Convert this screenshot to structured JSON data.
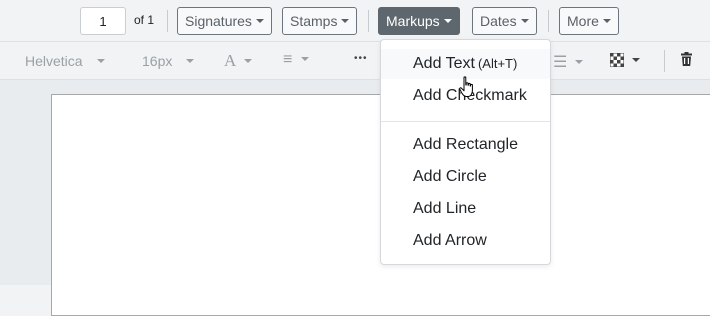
{
  "toolbar": {
    "page_input_value": "1",
    "page_of_label": "of 1",
    "signatures_label": "Signatures",
    "stamps_label": "Stamps",
    "markups_label": "Markups",
    "dates_label": "Dates",
    "more_label": "More"
  },
  "format_bar": {
    "font_family": "Helvetica",
    "font_size": "16px",
    "text_color_glyph": "A",
    "align_glyph": "≡",
    "overflow_glyph": "•••"
  },
  "markups_menu": {
    "items": [
      {
        "label": "Add Text",
        "shortcut": "(Alt+T)"
      },
      {
        "label": "Add Checkmark"
      },
      {
        "label": "Add Rectangle"
      },
      {
        "label": "Add Circle"
      },
      {
        "label": "Add Line"
      },
      {
        "label": "Add Arrow"
      }
    ]
  },
  "colors": {
    "active_button": "#5f676e",
    "button_border": "#6c757d",
    "toolbar_bg": "#f1f3f5"
  },
  "icons": [
    "text-color-icon",
    "align-left-icon",
    "more-options-icon",
    "line-style-icon",
    "fill-pattern-icon",
    "trash-icon",
    "hand-pointer-cursor-icon"
  ]
}
